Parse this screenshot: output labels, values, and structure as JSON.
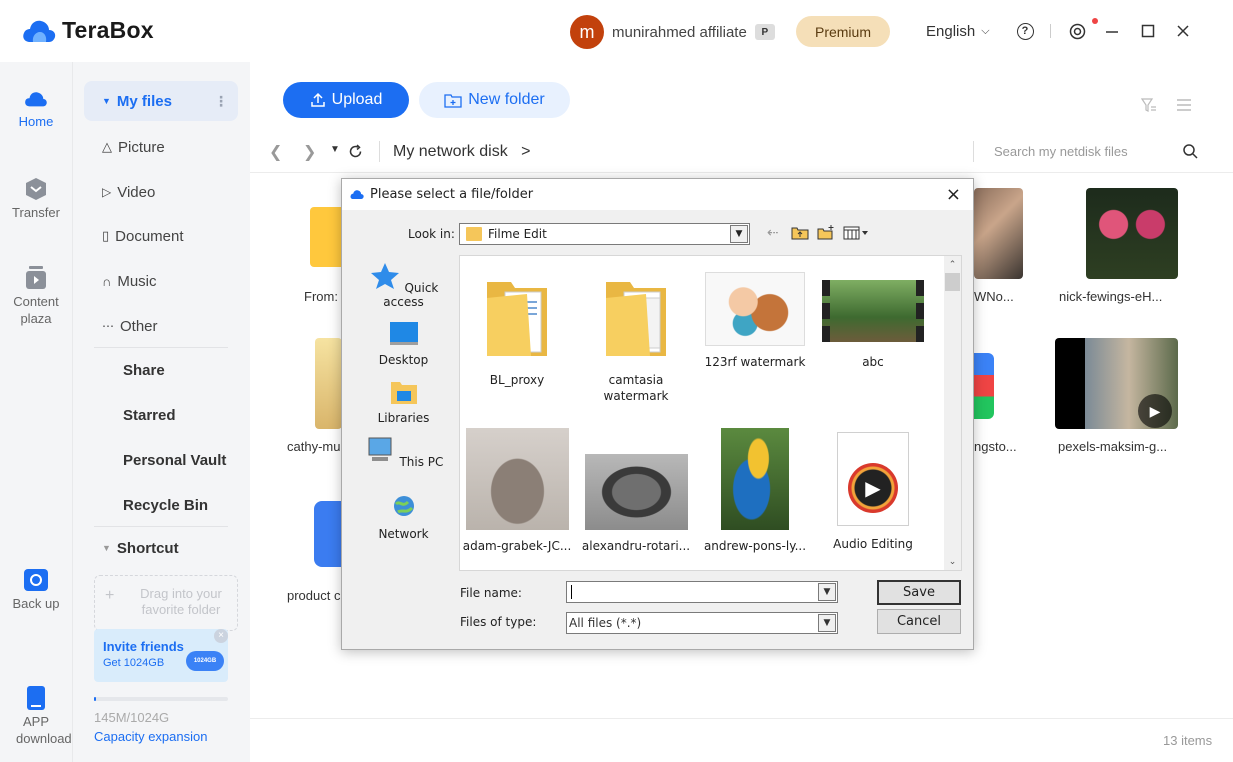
{
  "app": {
    "name": "TeraBox"
  },
  "header": {
    "avatar_letter": "m",
    "username": "munirahmed affiliate",
    "vip_badge": "P",
    "premium_label": "Premium",
    "language": "English",
    "help_glyph": "?"
  },
  "rail": {
    "items": [
      {
        "label": "Home",
        "icon": "home-icon"
      },
      {
        "label": "Transfer",
        "icon": "transfer-icon"
      },
      {
        "label": "Content plaza",
        "icon": "content-plaza-icon"
      },
      {
        "label": "Back up",
        "icon": "backup-icon"
      },
      {
        "label": "APP download",
        "icon": "app-download-icon"
      }
    ]
  },
  "sidebar": {
    "my_files": "My files",
    "items": [
      "Picture",
      "Video",
      "Document",
      "Music",
      "Other"
    ],
    "sections": [
      "Share",
      "Starred",
      "Personal Vault",
      "Recycle Bin"
    ],
    "shortcut": "Shortcut",
    "drag_hint": "Drag into your favorite folder",
    "invite_title": "Invite friends",
    "invite_sub": "Get 1024GB",
    "invite_badge": "1024GB",
    "capacity_text": "145M/1024G",
    "capacity_fraction": 0.001,
    "capacity_link": "Capacity expansion"
  },
  "toolbar": {
    "upload_label": "Upload",
    "new_folder_label": "New folder"
  },
  "breadcrumb": {
    "path": "My network disk",
    "sep": ">"
  },
  "search": {
    "placeholder": "Search my netdisk files"
  },
  "files_behind": {
    "row1": [
      "From:",
      "WNo...",
      "nick-fewings-eH..."
    ],
    "row2": [
      "cathy-mu",
      "ngsto...",
      "pexels-maksim-g..."
    ],
    "row3": [
      "product c"
    ]
  },
  "footer": {
    "items_count": "13 items"
  },
  "dialog": {
    "title": "Please select a file/folder",
    "look_in_label": "Look in:",
    "look_in_value": "Filme Edit",
    "places": [
      "Quick access",
      "Desktop",
      "Libraries",
      "This PC",
      "Network"
    ],
    "files": [
      {
        "name": "BL_proxy",
        "kind": "folder"
      },
      {
        "name": "camtasia watermark",
        "kind": "folder"
      },
      {
        "name": "123rf watermark",
        "kind": "image"
      },
      {
        "name": "abc",
        "kind": "video"
      },
      {
        "name": "adam-grabek-JC...",
        "kind": "image"
      },
      {
        "name": "alexandru-rotari...",
        "kind": "image"
      },
      {
        "name": "andrew-pons-ly...",
        "kind": "image"
      },
      {
        "name": "Audio Editing",
        "kind": "media"
      }
    ],
    "file_name_label": "File name:",
    "file_name_value": "",
    "file_type_label": "Files of type:",
    "file_type_value": "All files (*.*)",
    "save_label": "Save",
    "cancel_label": "Cancel"
  },
  "colors": {
    "accent": "#1c6ef2",
    "premium_bg": "#f5dfb8",
    "avatar_bg": "#c2410c"
  }
}
